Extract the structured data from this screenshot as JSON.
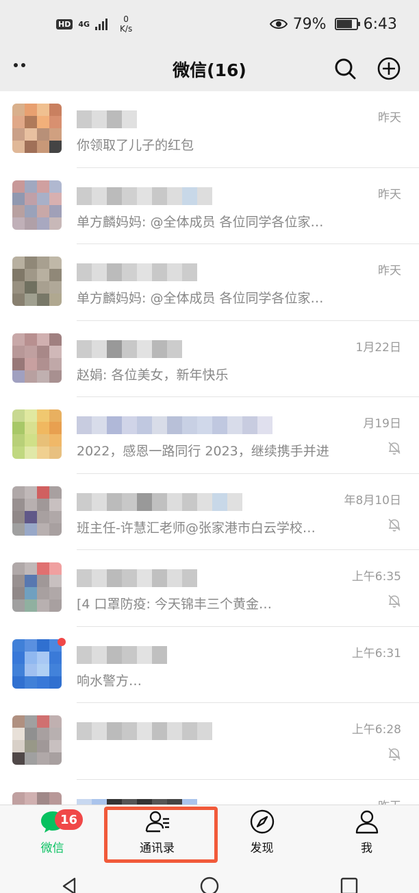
{
  "status_bar": {
    "hd": "HD",
    "network": "4G",
    "speed_value": "0",
    "speed_unit": "K/s",
    "battery_percent": "79%",
    "battery_level": 0.79,
    "time": "6:43"
  },
  "header": {
    "title": "微信(16)"
  },
  "chats": [
    {
      "preview": "你领取了儿子的红包",
      "time": "昨天",
      "muted": false
    },
    {
      "preview": "单方麟妈妈: @全体成员 各位同学各位家…",
      "time": "昨天",
      "muted": false
    },
    {
      "preview": "单方麟妈妈: @全体成员 各位同学各位家…",
      "time": "昨天",
      "muted": false
    },
    {
      "preview": "赵娟: 各位美女，新年快乐",
      "time": "1月22日",
      "muted": false
    },
    {
      "preview": "2022，感恩一路同行 2023，继续携手并进",
      "time": "月19日",
      "muted": true
    },
    {
      "preview": "班主任-许慧汇老师@张家港市白云学校…",
      "time": "年8月10日",
      "muted": true
    },
    {
      "preview": "[4 口罩防疫: 今天锦丰三个黄金…",
      "time": "上午6:35",
      "muted": true
    },
    {
      "preview": "响水警方…",
      "time": "上午6:31",
      "muted": false
    },
    {
      "preview": "",
      "time": "上午6:28",
      "muted": true
    },
    {
      "preview": "",
      "time": "昨天",
      "muted": false
    }
  ],
  "nav": {
    "chats_label": "微信",
    "chats_badge": "16",
    "contacts_label": "通讯录",
    "discover_label": "发现",
    "me_label": "我"
  },
  "colors": {
    "accent": "#07c160",
    "badge": "#f04848",
    "highlight": "#f15a3a"
  }
}
